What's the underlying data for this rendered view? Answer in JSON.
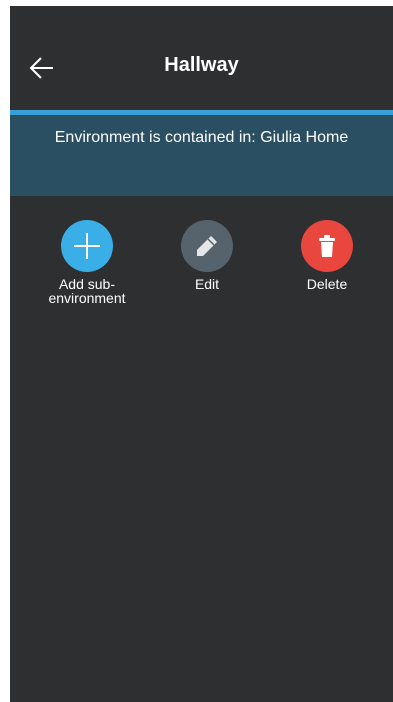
{
  "header": {
    "title": "Hallway"
  },
  "banner": {
    "text": "Environment is contained in: Giulia Home"
  },
  "actions": [
    {
      "label": "Add sub-\nenvironment",
      "icon": "plus-icon",
      "color": "#3aaee6"
    },
    {
      "label": "Edit",
      "icon": "pencil-icon",
      "color": "#56636d"
    },
    {
      "label": "Delete",
      "icon": "trash-icon",
      "color": "#e9463e"
    }
  ],
  "colors": {
    "background": "#2e2f31",
    "accent": "#3a9fd6",
    "banner": "#2a4e62"
  }
}
